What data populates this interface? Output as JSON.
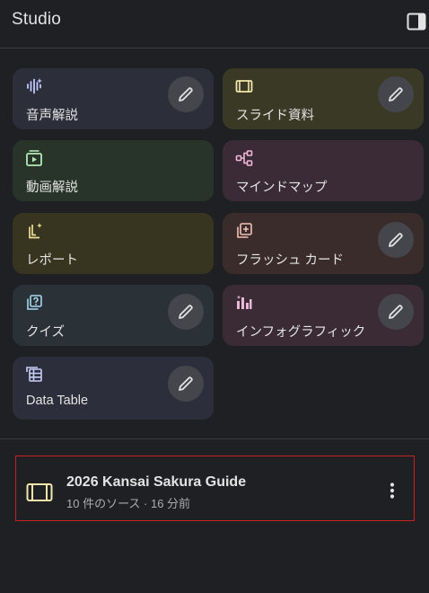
{
  "header": {
    "title": "Studio",
    "toggle_icon": "side-panel-icon"
  },
  "cards": [
    {
      "label": "音声解説",
      "icon": "audio-waveform-icon",
      "color": "#2c2e3a",
      "accent": "#c4c8ff"
    },
    {
      "label": "スライド資料",
      "icon": "slides-icon",
      "color": "#3a3926",
      "accent": "#f2e7a8"
    },
    {
      "label": "動画解説",
      "icon": "video-overview-icon",
      "color": "#283329",
      "accent": "#b3e8b5"
    },
    {
      "label": "マインドマップ",
      "icon": "mind-map-icon",
      "color": "#3a2b36",
      "accent": "#f0b6d8"
    },
    {
      "label": "レポート",
      "icon": "report-icon",
      "color": "#37341f",
      "accent": "#ecdf96"
    },
    {
      "label": "フラッシュ カード",
      "icon": "flashcards-icon",
      "color": "#3a2c2b",
      "accent": "#f3c1b7"
    },
    {
      "label": "クイズ",
      "icon": "quiz-icon",
      "color": "#2a3137",
      "accent": "#a8d8ee"
    },
    {
      "label": "インフォグラフィック",
      "icon": "infographic-icon",
      "color": "#3a2b35",
      "accent": "#e9b8d6"
    },
    {
      "label": "Data Table",
      "icon": "data-table-icon",
      "color": "#2c2e3b",
      "accent": "#c9cdf6"
    }
  ],
  "note": {
    "title": "2026 Kansai Sakura Guide",
    "meta": "10 件のソース · 16 分前",
    "icon": "slides-icon",
    "menu_icon": "more-vert-icon"
  }
}
